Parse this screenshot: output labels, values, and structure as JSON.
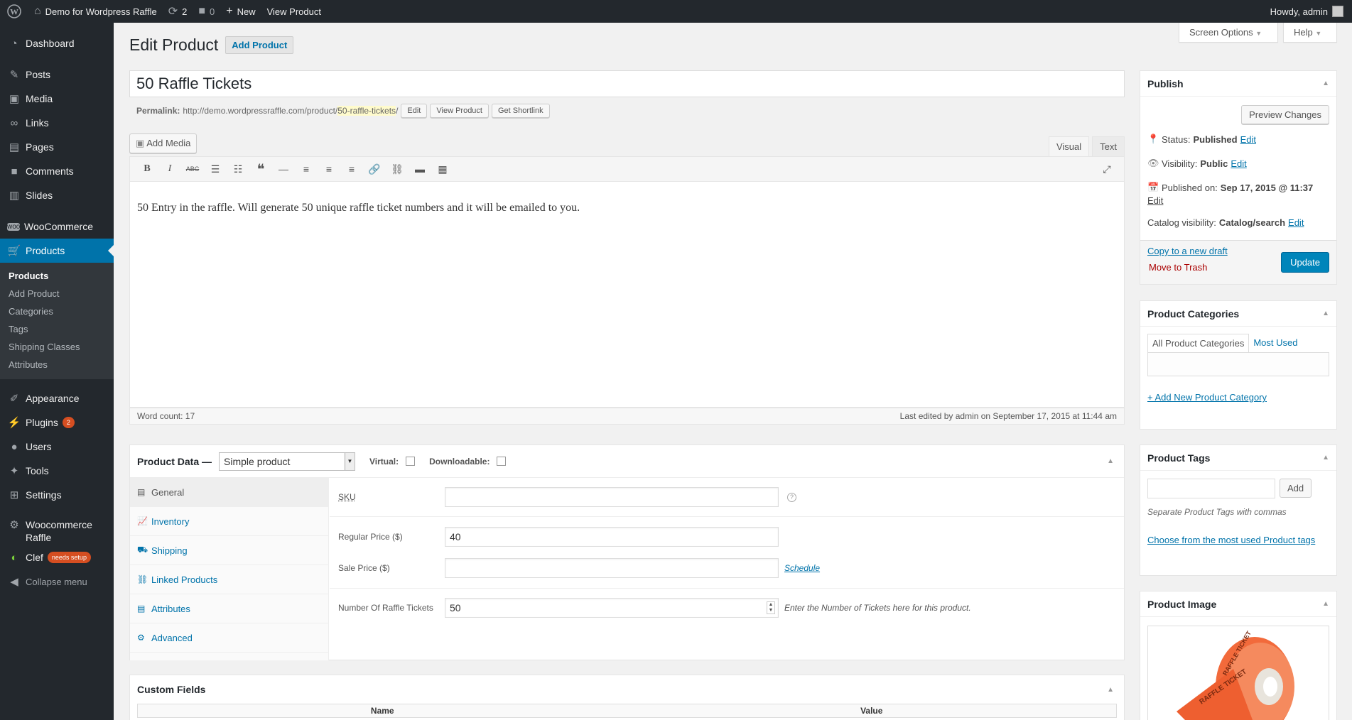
{
  "adminbar": {
    "site_name": "Demo for Wordpress Raffle",
    "updates_count": "2",
    "comments_count": "0",
    "new_label": "New",
    "view_label": "View Product",
    "howdy": "Howdy, admin"
  },
  "sidebar": {
    "items": [
      {
        "label": "Dashboard",
        "icon": "dashboard-icon"
      },
      {
        "label": "Posts",
        "icon": "pin-icon"
      },
      {
        "label": "Media",
        "icon": "media-icon"
      },
      {
        "label": "Links",
        "icon": "link-icon"
      },
      {
        "label": "Pages",
        "icon": "page-icon"
      },
      {
        "label": "Comments",
        "icon": "comment-icon"
      },
      {
        "label": "Slides",
        "icon": "slides-icon"
      },
      {
        "label": "WooCommerce",
        "icon": "woo-icon"
      },
      {
        "label": "Products",
        "icon": "cart-icon"
      },
      {
        "label": "Appearance",
        "icon": "brush-icon"
      },
      {
        "label": "Plugins",
        "icon": "plugin-icon",
        "badge": "2"
      },
      {
        "label": "Users",
        "icon": "user-icon"
      },
      {
        "label": "Tools",
        "icon": "wrench-icon"
      },
      {
        "label": "Settings",
        "icon": "settings-icon"
      },
      {
        "label": "Woocommerce Raffle",
        "icon": "gear-icon"
      },
      {
        "label": "Clef",
        "icon": "clef-icon",
        "badge": "needs setup"
      },
      {
        "label": "Collapse menu",
        "icon": "collapse-icon"
      }
    ],
    "submenu": [
      "Products",
      "Add Product",
      "Categories",
      "Tags",
      "Shipping Classes",
      "Attributes"
    ]
  },
  "header": {
    "title": "Edit Product",
    "add_button": "Add Product",
    "screen_options": "Screen Options",
    "help": "Help"
  },
  "post": {
    "title": "50 Raffle Tickets",
    "permalink_label": "Permalink:",
    "permalink_base": "http://demo.wordpressraffle.com/product/",
    "permalink_slug": "50-raffle-tickets",
    "permalink_end": "/",
    "edit_btn": "Edit",
    "view_btn": "View Product",
    "shortlink_btn": "Get Shortlink"
  },
  "editor": {
    "add_media": "Add Media",
    "tab_visual": "Visual",
    "tab_text": "Text",
    "content": "50 Entry in the raffle.  Will generate 50 unique raffle ticket numbers and it will be emailed to you.",
    "word_count": "Word count: 17",
    "last_edited": "Last edited by admin on September 17, 2015 at 11:44 am"
  },
  "product_data": {
    "label": "Product Data —",
    "type": "Simple product",
    "virtual": "Virtual:",
    "downloadable": "Downloadable:",
    "tabs": [
      "General",
      "Inventory",
      "Shipping",
      "Linked Products",
      "Attributes",
      "Advanced"
    ],
    "sku_label": "SKU",
    "sku_value": "",
    "regular_price_label": "Regular Price ($)",
    "regular_price": "40",
    "sale_price_label": "Sale Price ($)",
    "sale_price": "",
    "schedule": "Schedule",
    "tickets_label": "Number Of Raffle Tickets",
    "tickets_value": "50",
    "tickets_hint": "Enter the Number of Tickets here for this product."
  },
  "custom_fields": {
    "title": "Custom Fields",
    "col_name": "Name",
    "col_value": "Value"
  },
  "publish": {
    "title": "Publish",
    "preview": "Preview Changes",
    "status_label": "Status:",
    "status_value": "Published",
    "visibility_label": "Visibility:",
    "visibility_value": "Public",
    "published_label": "Published on:",
    "published_value": "Sep 17, 2015 @ 11:37",
    "catalog_label": "Catalog visibility:",
    "catalog_value": "Catalog/search",
    "edit": "Edit",
    "copy_draft": "Copy to a new draft",
    "trash": "Move to Trash",
    "update": "Update"
  },
  "categories": {
    "title": "Product Categories",
    "tab_all": "All Product Categories",
    "tab_used": "Most Used",
    "add_new": "+ Add New Product Category"
  },
  "tags": {
    "title": "Product Tags",
    "add": "Add",
    "hint": "Separate Product Tags with commas",
    "choose": "Choose from the most used Product tags"
  },
  "image": {
    "title": "Product Image",
    "ticket_text": "RAFFLE TICKET"
  },
  "colors": {
    "accent": "#0073aa",
    "adminbar": "#23282d",
    "primary_button": "#0085ba",
    "trash": "#a00000"
  }
}
